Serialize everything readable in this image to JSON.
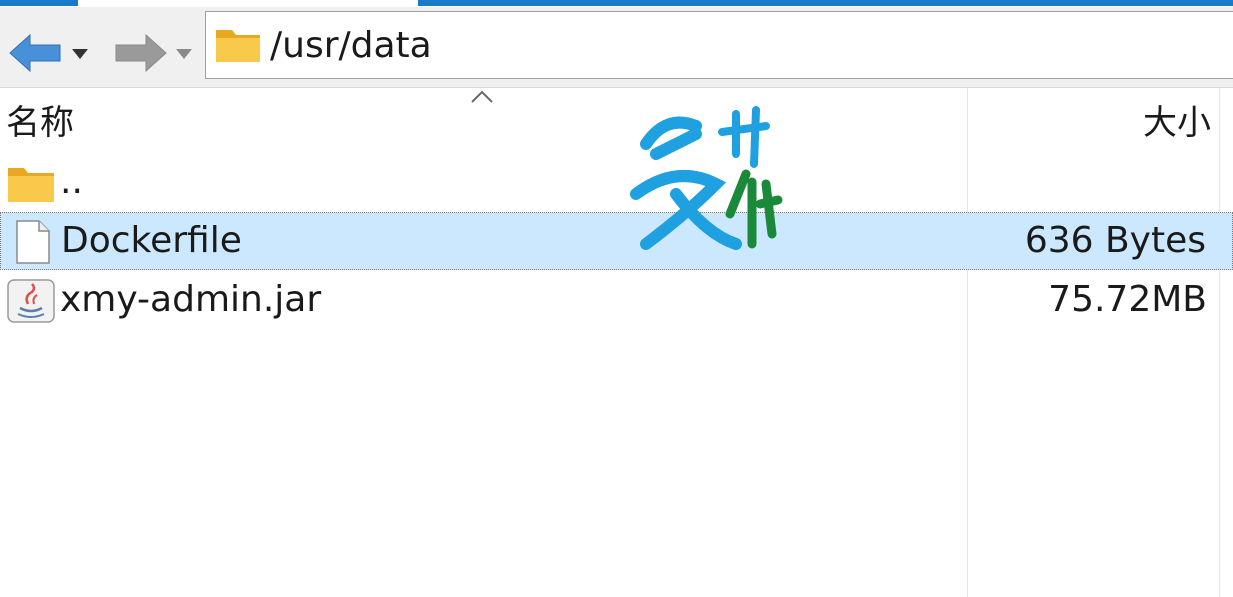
{
  "address": {
    "path": "/usr/data"
  },
  "columns": {
    "name": "名称",
    "size": "大小"
  },
  "files": [
    {
      "name": "..",
      "size": "",
      "icon": "folder-icon"
    },
    {
      "name": "Dockerfile",
      "size": "636 Bytes",
      "icon": "file-icon"
    },
    {
      "name": "xmy-admin.jar",
      "size": "75.72MB",
      "icon": "java-icon"
    }
  ],
  "colors": {
    "selection": "#cce8ff",
    "accent": "#1979ca",
    "folder": "#f5c342"
  }
}
